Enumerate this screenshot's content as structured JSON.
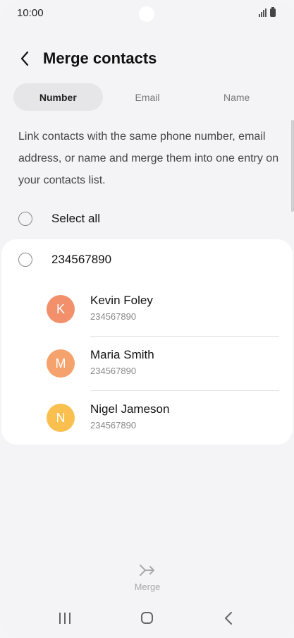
{
  "status_bar": {
    "time": "10:00"
  },
  "header": {
    "title": "Merge contacts"
  },
  "tabs": [
    {
      "label": "Number",
      "active": true
    },
    {
      "label": "Email",
      "active": false
    },
    {
      "label": "Name",
      "active": false
    }
  ],
  "description": "Link contacts with the same phone number, email address, or name and merge them into one entry on your contacts list.",
  "select_all": {
    "label": "Select all",
    "checked": false
  },
  "group": {
    "number": "234567890",
    "checked": false,
    "contacts": [
      {
        "initial": "K",
        "name": "Kevin Foley",
        "number": "234567890",
        "color": "#f2906b"
      },
      {
        "initial": "M",
        "name": "Maria Smith",
        "number": "234567890",
        "color": "#f5a26c"
      },
      {
        "initial": "N",
        "name": "Nigel Jameson",
        "number": "234567890",
        "color": "#f9c04f"
      }
    ]
  },
  "actions": {
    "merge_label": "Merge"
  },
  "icons": {
    "back": "back-arrow-icon",
    "merge": "merge-arrows-icon",
    "signal": "signal-icon",
    "battery": "battery-icon"
  }
}
